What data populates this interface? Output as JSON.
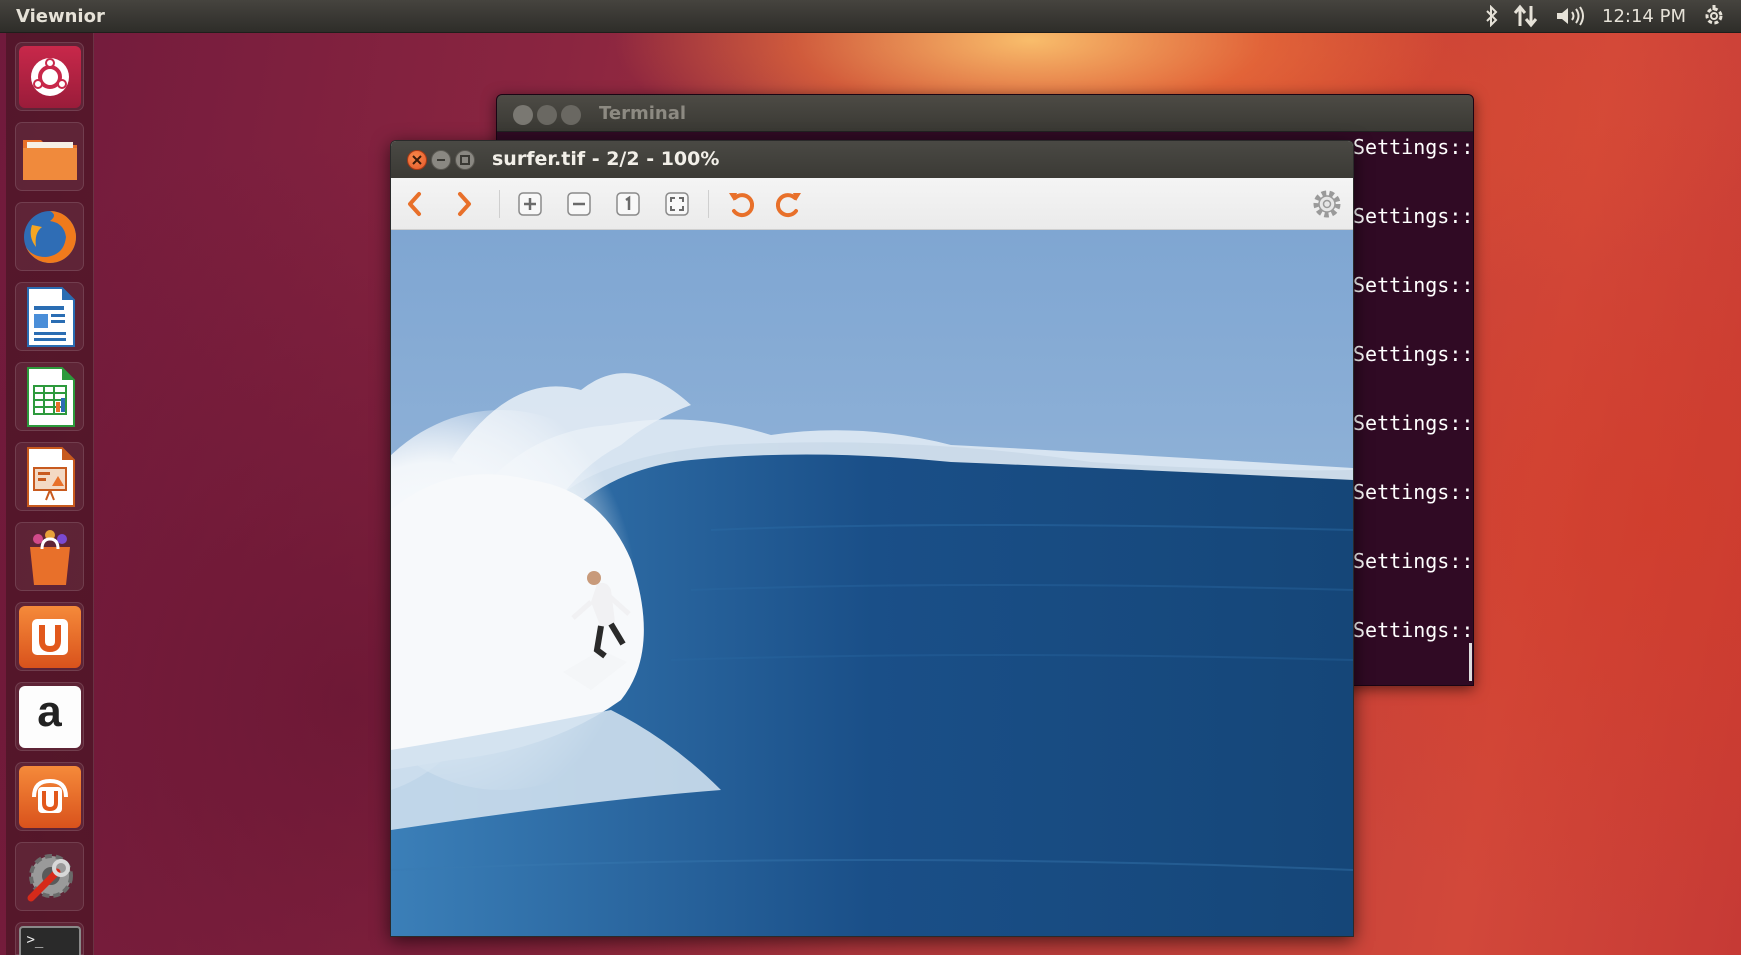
{
  "panel": {
    "app_title": "Viewnior",
    "clock": "12:14 PM",
    "indicators": [
      "bluetooth-icon",
      "network-icon",
      "volume-icon",
      "session-gear-icon"
    ]
  },
  "launcher": {
    "items": [
      {
        "name": "dash-home",
        "icon": "ubuntu-logo-icon"
      },
      {
        "name": "files",
        "icon": "folder-icon"
      },
      {
        "name": "firefox",
        "icon": "firefox-icon"
      },
      {
        "name": "libreoffice-writer",
        "icon": "writer-icon"
      },
      {
        "name": "libreoffice-calc",
        "icon": "calc-icon"
      },
      {
        "name": "libreoffice-impress",
        "icon": "impress-icon"
      },
      {
        "name": "software-center",
        "icon": "shopping-bag-icon"
      },
      {
        "name": "ubuntu-one",
        "icon": "ubuntu-one-icon"
      },
      {
        "name": "amazon",
        "icon": "amazon-icon"
      },
      {
        "name": "ubuntu-one-music",
        "icon": "ubuntu-one-music-icon"
      },
      {
        "name": "system-settings",
        "icon": "settings-wrench-icon"
      },
      {
        "name": "terminal",
        "icon": "terminal-icon"
      }
    ],
    "amazon_letter": "a",
    "u_letter": "U",
    "terminal_prompt": ">_"
  },
  "terminal": {
    "title": "Terminal",
    "lines": [
      "Settings::",
      "Settings::",
      "Settings::",
      "Settings::",
      "Settings::",
      "Settings::",
      "Settings::",
      "Settings::"
    ]
  },
  "viewer": {
    "title": "surfer.tif - 2/2 - 100%",
    "toolbar": [
      "previous-icon",
      "next-icon",
      "zoom-in-icon",
      "zoom-out-icon",
      "normal-size-icon",
      "fit-to-window-icon",
      "rotate-left-icon",
      "rotate-right-icon",
      "preferences-gear-icon"
    ],
    "image_subject": "surfer"
  },
  "colors": {
    "ubuntu_orange": "#dd4814",
    "terminal_bg": "#300a24",
    "panel_bg": "#3c3b37",
    "close_button": "#e5582b"
  }
}
